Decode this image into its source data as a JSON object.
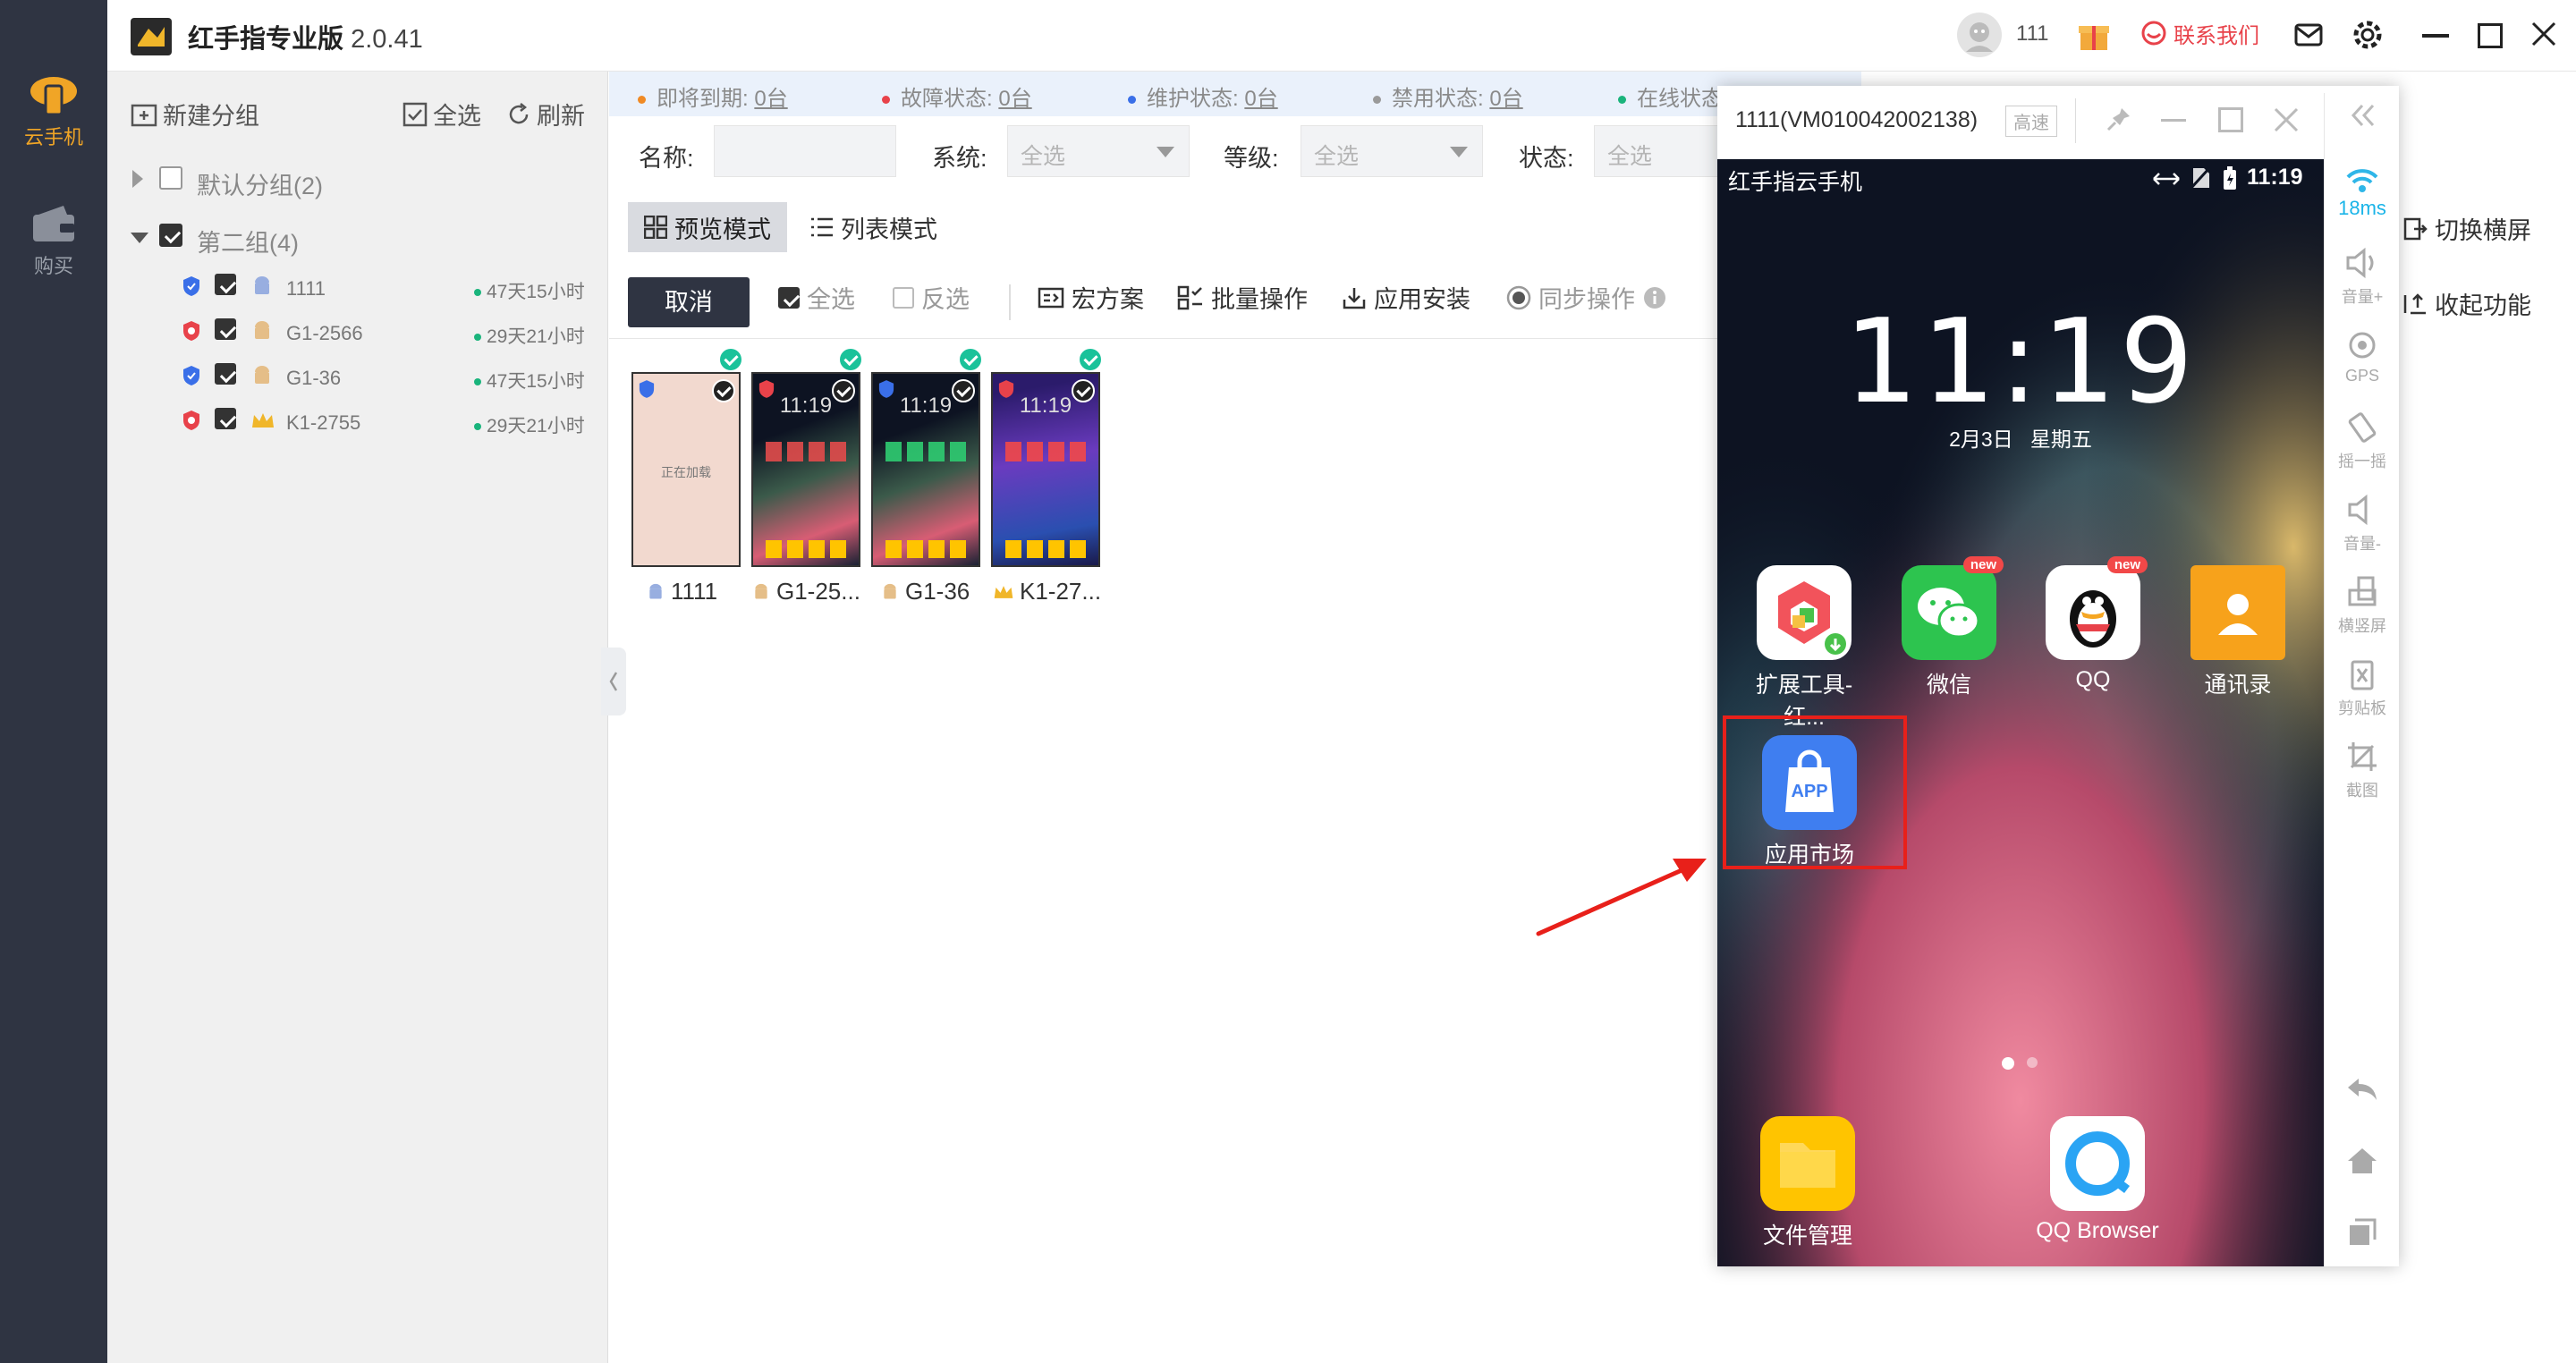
{
  "app": {
    "name": "红手指专业版",
    "version": "2.0.41"
  },
  "rail": {
    "items": [
      {
        "label": "云手机",
        "icon": "cloud-phone-icon",
        "active": true
      },
      {
        "label": "购买",
        "icon": "wallet-icon",
        "active": false
      }
    ]
  },
  "titlebar": {
    "user_id": "111",
    "contact_label": "联系我们"
  },
  "colors": {
    "accent": "#f0a526",
    "brand_red": "#e8424a",
    "dark": "#2f3442",
    "online_green": "#1ab47c"
  },
  "group_panel": {
    "new_group": "新建分组",
    "select_all": "全选",
    "refresh": "刷新",
    "groups": [
      {
        "name": "默认分组(2)",
        "expanded": false,
        "checked": false
      },
      {
        "name": "第二组(4)",
        "expanded": true,
        "checked": true
      }
    ],
    "devices": [
      {
        "name": "1111",
        "time": "47天15小时",
        "shield": "blue",
        "os": "android"
      },
      {
        "name": "G1-2566",
        "time": "29天21小时",
        "shield": "red",
        "os": "android"
      },
      {
        "name": "G1-36",
        "time": "47天15小时",
        "shield": "blue",
        "os": "android"
      },
      {
        "name": "K1-2755",
        "time": "29天21小时",
        "shield": "red",
        "os": "crown"
      }
    ]
  },
  "status_strip": [
    {
      "label": "即将到期:",
      "value": "0台",
      "color": "#f08a24"
    },
    {
      "label": "故障状态:",
      "value": "0台",
      "color": "#e8424a"
    },
    {
      "label": "维护状态:",
      "value": "0台",
      "color": "#3a6fe8"
    },
    {
      "label": "禁用状态:",
      "value": "0台",
      "color": "#9a9a9a"
    },
    {
      "label": "在线状态",
      "value": "",
      "color": "#1ab47c"
    }
  ],
  "filters": {
    "name_label": "名称:",
    "name_value": "",
    "system_label": "系统:",
    "system_value": "全选",
    "level_label": "等级:",
    "level_value": "全选",
    "status_label": "状态:",
    "status_value": "全选"
  },
  "modes": {
    "preview": "预览模式",
    "list": "列表模式",
    "active": "preview"
  },
  "toolbar": {
    "cancel": "取消",
    "select_all": "全选",
    "invert": "反选",
    "macro": "宏方案",
    "batch": "批量操作",
    "install": "应用安装",
    "sync": "同步操作"
  },
  "thumbnails": [
    {
      "label": "1111",
      "screen_text": "正在加载",
      "clock": ""
    },
    {
      "label": "G1-25...",
      "screen_text": "",
      "clock": "11:19"
    },
    {
      "label": "G1-36",
      "screen_text": "",
      "clock": "11:19"
    },
    {
      "label": "K1-27...",
      "screen_text": "",
      "clock": "11:19"
    }
  ],
  "right_actions": {
    "landscape": "切换横屏",
    "collapse": "收起功能"
  },
  "popup": {
    "title": "1111(VM010042002138)",
    "quality": "高速",
    "status_carrier": "红手指云手机",
    "status_time": "11:19",
    "clock": "11:19",
    "date": "2月3日",
    "weekday": "星期五",
    "apps": [
      {
        "label": "扩展工具-红...",
        "icon": "extension-tool-icon",
        "badge": ""
      },
      {
        "label": "微信",
        "icon": "wechat-icon",
        "badge": "new"
      },
      {
        "label": "QQ",
        "icon": "qq-icon",
        "badge": "new"
      },
      {
        "label": "通讯录",
        "icon": "contacts-icon",
        "badge": ""
      },
      {
        "label": "应用市场",
        "icon": "app-market-icon",
        "badge": "",
        "icon_text": "APP",
        "highlighted": true
      }
    ],
    "dock": [
      {
        "label": "文件管理",
        "icon": "file-manager-icon"
      },
      {
        "label": "QQ Browser",
        "icon": "qq-browser-icon"
      }
    ],
    "tools": [
      {
        "label": "18ms",
        "icon": "wifi-icon"
      },
      {
        "label": "音量+",
        "icon": "volume-up-icon"
      },
      {
        "label": "GPS",
        "icon": "gps-icon"
      },
      {
        "label": "摇一摇",
        "icon": "shake-icon"
      },
      {
        "label": "音量-",
        "icon": "volume-down-icon"
      },
      {
        "label": "横竖屏",
        "icon": "rotate-icon"
      },
      {
        "label": "剪贴板",
        "icon": "clipboard-icon"
      },
      {
        "label": "截图",
        "icon": "screenshot-icon"
      }
    ]
  }
}
